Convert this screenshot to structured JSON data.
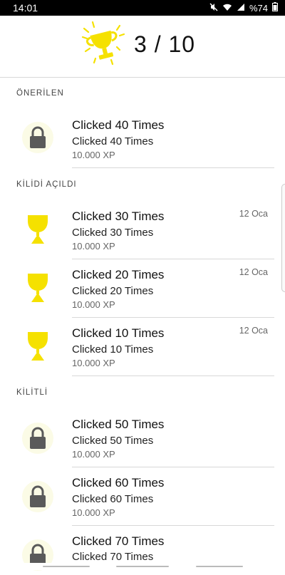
{
  "status_bar": {
    "time": "14:01",
    "battery": "%74"
  },
  "header": {
    "score": "3 / 10"
  },
  "sections": {
    "recommended": "ÖNERİLEN",
    "unlocked": "KİLİDİ AÇILDI",
    "locked": "KİLİTLİ"
  },
  "recommended_items": [
    {
      "title": "Clicked 40 Times",
      "subtitle": "Clicked 40 Times",
      "xp": "10.000 XP"
    }
  ],
  "unlocked_items": [
    {
      "title": "Clicked 30 Times",
      "subtitle": "Clicked 30 Times",
      "xp": "10.000 XP",
      "date": "12 Oca"
    },
    {
      "title": "Clicked 20 Times",
      "subtitle": "Clicked 20 Times",
      "xp": "10.000 XP",
      "date": "12 Oca"
    },
    {
      "title": "Clicked 10 Times",
      "subtitle": "Clicked 10 Times",
      "xp": "10.000 XP",
      "date": "12 Oca"
    }
  ],
  "locked_items": [
    {
      "title": "Clicked 50 Times",
      "subtitle": "Clicked 50 Times",
      "xp": "10.000 XP"
    },
    {
      "title": "Clicked 60 Times",
      "subtitle": "Clicked 60 Times",
      "xp": "10.000 XP"
    },
    {
      "title": "Clicked 70 Times",
      "subtitle": "Clicked 70 Times"
    }
  ],
  "colors": {
    "trophy": "#f5e100",
    "lock": "#5a5a5a",
    "lock_bg": "#fbfbe6"
  },
  "icons": {
    "trophy": "trophy-icon",
    "lock": "lock-icon"
  }
}
